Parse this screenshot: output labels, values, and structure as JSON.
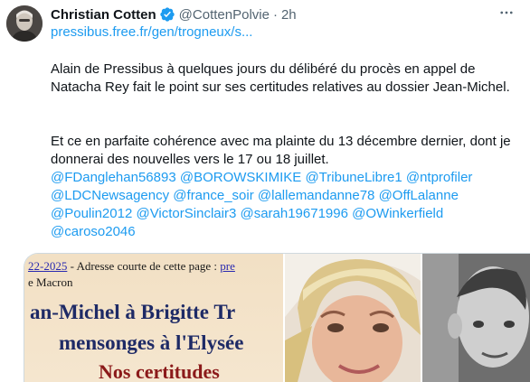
{
  "tweet": {
    "author": {
      "display_name": "Christian Cotten",
      "handle": "@CottenPolvie",
      "verified": true,
      "avatar": "profile-photo"
    },
    "separator": "·",
    "time": "2h",
    "more_icon": "more-horizontal-icon",
    "link": "pressibus.free.fr/gen/trogneux/s...",
    "paragraph_1": "Alain de Pressibus à quelques jours du délibéré du procès en appel de Natacha Rey fait le point sur ses certitudes relatives au dossier Jean-Michel.",
    "paragraph_2": "Et ce en parfaite cohérence avec ma plainte du 13 décembre dernier, dont je donnerai des nouvelles vers le 17 ou 18 juillet.",
    "mentions": [
      "@FDanglehan56893",
      "@BOROWSKIMIKE",
      "@TribuneLibre1",
      "@ntprofiler",
      "@LDCNewsagency",
      "@france_soir",
      "@lallemandanne78",
      "@OffLalanne",
      "@Poulin2012",
      "@VictorSinclair3",
      "@sarah19671996",
      "@OWinkerfield",
      "@caroso2046"
    ],
    "media": {
      "doc_date": "22-2025",
      "doc_line1": " - Adresse courte de cette page : ",
      "doc_url": "pre",
      "doc_line2": "e Macron",
      "doc_heading_1": "an-Michel à Brigitte Tr",
      "doc_heading_2": "mensonges à l'Elysée",
      "doc_heading_3": "Nos certitudes"
    }
  },
  "colors": {
    "link": "#1d9bf0",
    "verified": "#1d9bf0",
    "text": "#0f1419",
    "secondary": "#536471"
  }
}
